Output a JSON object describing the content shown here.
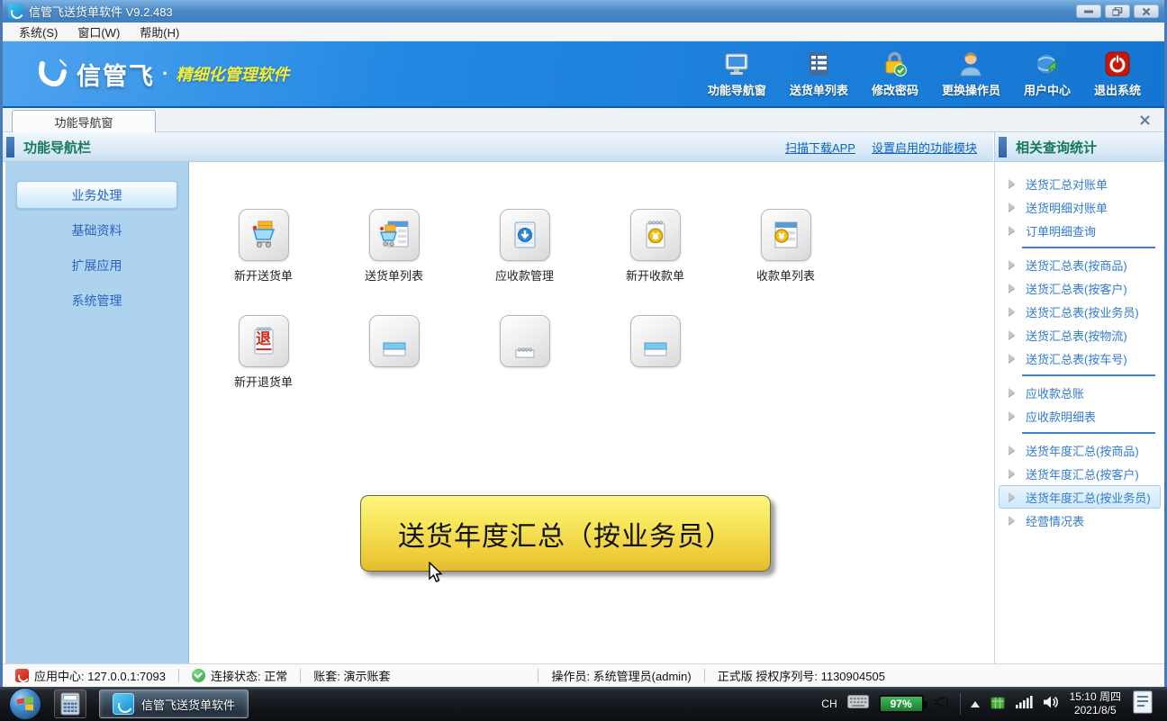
{
  "window": {
    "title": "信管飞送货单软件 V9.2.483"
  },
  "menu": {
    "items": [
      {
        "label": "系统(S)"
      },
      {
        "label": "窗口(W)"
      },
      {
        "label": "帮助(H)"
      }
    ]
  },
  "banner": {
    "brand": "信管飞",
    "dot": "·",
    "slogan": "精细化管理软件",
    "buttons": [
      {
        "label": "功能导航窗"
      },
      {
        "label": "送货单列表"
      },
      {
        "label": "修改密码"
      },
      {
        "label": "更换操作员"
      },
      {
        "label": "用户中心"
      },
      {
        "label": "退出系统"
      }
    ]
  },
  "tabs": {
    "active_label": "功能导航窗"
  },
  "left_header": {
    "title": "功能导航栏",
    "link_download": "扫描下载APP",
    "link_modules": "设置启用的功能模块"
  },
  "right_header": {
    "title": "相关查询统计"
  },
  "sidebar": {
    "items": [
      {
        "label": "业务处理"
      },
      {
        "label": "基础资料"
      },
      {
        "label": "扩展应用"
      },
      {
        "label": "系统管理"
      }
    ]
  },
  "launcher": {
    "row1": [
      {
        "label": "新开送货单"
      },
      {
        "label": "送货单列表"
      },
      {
        "label": "应收款管理"
      },
      {
        "label": "新开收款单"
      },
      {
        "label": "收款单列表"
      }
    ],
    "row2": [
      {
        "label": "新开退货单",
        "icon_char": "退"
      }
    ]
  },
  "tooltip": {
    "text": "送货年度汇总（按业务员）"
  },
  "right_panel": {
    "items": [
      {
        "label": "送货汇总对账单"
      },
      {
        "label": "送货明细对账单"
      },
      {
        "label": "订单明细查询"
      },
      {
        "label": "送货汇总表(按商品)"
      },
      {
        "label": "送货汇总表(按客户)"
      },
      {
        "label": "送货汇总表(按业务员)"
      },
      {
        "label": "送货汇总表(按物流)"
      },
      {
        "label": "送货汇总表(按车号)"
      },
      {
        "label": "应收款总账"
      },
      {
        "label": "应收款明细表"
      },
      {
        "label": "送货年度汇总(按商品)"
      },
      {
        "label": "送货年度汇总(按客户)"
      },
      {
        "label": "送货年度汇总(按业务员)"
      },
      {
        "label": "经营情况表"
      }
    ]
  },
  "status_bar": {
    "app_center": "应用中心: 127.0.0.1:7093",
    "connection": "连接状态: 正常",
    "account": "账套: 演示账套",
    "operator": "操作员: 系统管理员(admin)",
    "license": "正式版 授权序列号: 1130904505"
  },
  "taskbar": {
    "app_label": "信管飞送货单软件",
    "tray": {
      "lang": "CH",
      "battery_percent": "97%",
      "time": "15:10 周四",
      "date": "2021/8/5"
    }
  }
}
